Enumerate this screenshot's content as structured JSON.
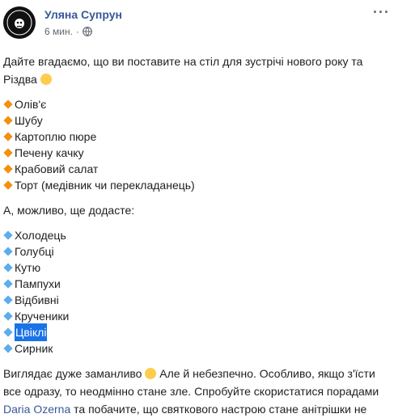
{
  "post": {
    "author": "Уляна Супрун",
    "time": "6 мин.",
    "separator": "·",
    "more_label": "···",
    "intro": "Дайте вгадаємо, що ви поставите на стіл для зустрічі нового року та Різдва",
    "list1": [
      "Олів'є",
      "Шубу",
      "Картоплю пюре",
      "Печену качку",
      "Крабовий салат",
      "Торт (медівник чи перекладанець)"
    ],
    "middle": "А, можливо, ще додасте:",
    "list2": [
      "Холодець",
      "Голубці",
      "Кутю",
      "Пампухи",
      "Відбивні",
      "Крученики",
      "Цвіклі",
      "Сирник"
    ],
    "outro_1": "Виглядає дуже заманливо",
    "outro_2": "Але й небезпечно. Особливо, якщо з'їсти все одразу, то неодмінно стане зле. Спробуйте скористатися порадами",
    "outro_link": "Daria Ozerna",
    "outro_3": "та побачите, що святкового настрою стане анітрішки не",
    "colors": {
      "link": "#385898",
      "highlight": "#1a73e8",
      "orange_bullet": "#f4900c",
      "blue_bullet": "#5dadec"
    },
    "icons": [
      "avatar-logo",
      "globe-icon",
      "more-icon",
      "thinking-emoji",
      "smile-emoji",
      "orange-diamond-icon",
      "blue-diamond-icon"
    ]
  }
}
